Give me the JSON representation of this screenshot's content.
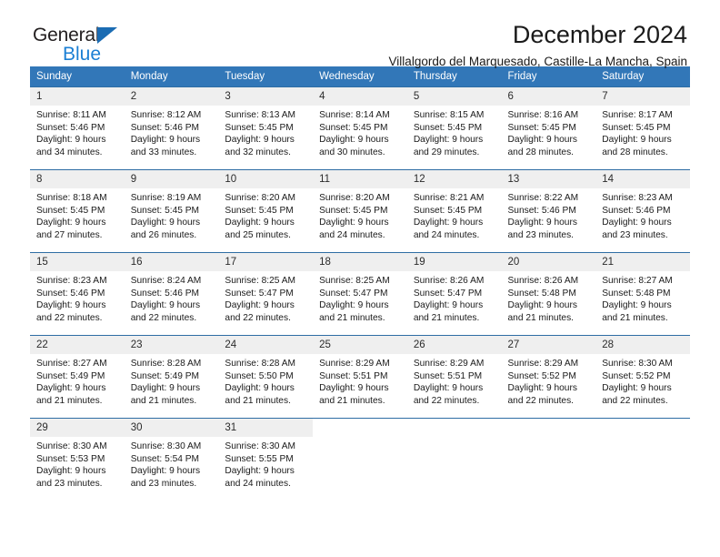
{
  "brand": {
    "line1": "General",
    "line2": "Blue",
    "color_dark": "#231f20",
    "color_blue": "#1b7fd4",
    "triangle_color": "#1b6cb3"
  },
  "header": {
    "title": "December 2024",
    "subtitle": "Villalgordo del Marquesado, Castille-La Mancha, Spain"
  },
  "theme": {
    "header_bg": "#3277b8",
    "rule_color": "#2e6da4",
    "daynum_bg": "#efefef"
  },
  "weekdays": [
    "Sunday",
    "Monday",
    "Tuesday",
    "Wednesday",
    "Thursday",
    "Friday",
    "Saturday"
  ],
  "weeks": [
    [
      {
        "day": "1",
        "sunrise": "Sunrise: 8:11 AM",
        "sunset": "Sunset: 5:46 PM",
        "daylight1": "Daylight: 9 hours",
        "daylight2": "and 34 minutes."
      },
      {
        "day": "2",
        "sunrise": "Sunrise: 8:12 AM",
        "sunset": "Sunset: 5:46 PM",
        "daylight1": "Daylight: 9 hours",
        "daylight2": "and 33 minutes."
      },
      {
        "day": "3",
        "sunrise": "Sunrise: 8:13 AM",
        "sunset": "Sunset: 5:45 PM",
        "daylight1": "Daylight: 9 hours",
        "daylight2": "and 32 minutes."
      },
      {
        "day": "4",
        "sunrise": "Sunrise: 8:14 AM",
        "sunset": "Sunset: 5:45 PM",
        "daylight1": "Daylight: 9 hours",
        "daylight2": "and 30 minutes."
      },
      {
        "day": "5",
        "sunrise": "Sunrise: 8:15 AM",
        "sunset": "Sunset: 5:45 PM",
        "daylight1": "Daylight: 9 hours",
        "daylight2": "and 29 minutes."
      },
      {
        "day": "6",
        "sunrise": "Sunrise: 8:16 AM",
        "sunset": "Sunset: 5:45 PM",
        "daylight1": "Daylight: 9 hours",
        "daylight2": "and 28 minutes."
      },
      {
        "day": "7",
        "sunrise": "Sunrise: 8:17 AM",
        "sunset": "Sunset: 5:45 PM",
        "daylight1": "Daylight: 9 hours",
        "daylight2": "and 28 minutes."
      }
    ],
    [
      {
        "day": "8",
        "sunrise": "Sunrise: 8:18 AM",
        "sunset": "Sunset: 5:45 PM",
        "daylight1": "Daylight: 9 hours",
        "daylight2": "and 27 minutes."
      },
      {
        "day": "9",
        "sunrise": "Sunrise: 8:19 AM",
        "sunset": "Sunset: 5:45 PM",
        "daylight1": "Daylight: 9 hours",
        "daylight2": "and 26 minutes."
      },
      {
        "day": "10",
        "sunrise": "Sunrise: 8:20 AM",
        "sunset": "Sunset: 5:45 PM",
        "daylight1": "Daylight: 9 hours",
        "daylight2": "and 25 minutes."
      },
      {
        "day": "11",
        "sunrise": "Sunrise: 8:20 AM",
        "sunset": "Sunset: 5:45 PM",
        "daylight1": "Daylight: 9 hours",
        "daylight2": "and 24 minutes."
      },
      {
        "day": "12",
        "sunrise": "Sunrise: 8:21 AM",
        "sunset": "Sunset: 5:45 PM",
        "daylight1": "Daylight: 9 hours",
        "daylight2": "and 24 minutes."
      },
      {
        "day": "13",
        "sunrise": "Sunrise: 8:22 AM",
        "sunset": "Sunset: 5:46 PM",
        "daylight1": "Daylight: 9 hours",
        "daylight2": "and 23 minutes."
      },
      {
        "day": "14",
        "sunrise": "Sunrise: 8:23 AM",
        "sunset": "Sunset: 5:46 PM",
        "daylight1": "Daylight: 9 hours",
        "daylight2": "and 23 minutes."
      }
    ],
    [
      {
        "day": "15",
        "sunrise": "Sunrise: 8:23 AM",
        "sunset": "Sunset: 5:46 PM",
        "daylight1": "Daylight: 9 hours",
        "daylight2": "and 22 minutes."
      },
      {
        "day": "16",
        "sunrise": "Sunrise: 8:24 AM",
        "sunset": "Sunset: 5:46 PM",
        "daylight1": "Daylight: 9 hours",
        "daylight2": "and 22 minutes."
      },
      {
        "day": "17",
        "sunrise": "Sunrise: 8:25 AM",
        "sunset": "Sunset: 5:47 PM",
        "daylight1": "Daylight: 9 hours",
        "daylight2": "and 22 minutes."
      },
      {
        "day": "18",
        "sunrise": "Sunrise: 8:25 AM",
        "sunset": "Sunset: 5:47 PM",
        "daylight1": "Daylight: 9 hours",
        "daylight2": "and 21 minutes."
      },
      {
        "day": "19",
        "sunrise": "Sunrise: 8:26 AM",
        "sunset": "Sunset: 5:47 PM",
        "daylight1": "Daylight: 9 hours",
        "daylight2": "and 21 minutes."
      },
      {
        "day": "20",
        "sunrise": "Sunrise: 8:26 AM",
        "sunset": "Sunset: 5:48 PM",
        "daylight1": "Daylight: 9 hours",
        "daylight2": "and 21 minutes."
      },
      {
        "day": "21",
        "sunrise": "Sunrise: 8:27 AM",
        "sunset": "Sunset: 5:48 PM",
        "daylight1": "Daylight: 9 hours",
        "daylight2": "and 21 minutes."
      }
    ],
    [
      {
        "day": "22",
        "sunrise": "Sunrise: 8:27 AM",
        "sunset": "Sunset: 5:49 PM",
        "daylight1": "Daylight: 9 hours",
        "daylight2": "and 21 minutes."
      },
      {
        "day": "23",
        "sunrise": "Sunrise: 8:28 AM",
        "sunset": "Sunset: 5:49 PM",
        "daylight1": "Daylight: 9 hours",
        "daylight2": "and 21 minutes."
      },
      {
        "day": "24",
        "sunrise": "Sunrise: 8:28 AM",
        "sunset": "Sunset: 5:50 PM",
        "daylight1": "Daylight: 9 hours",
        "daylight2": "and 21 minutes."
      },
      {
        "day": "25",
        "sunrise": "Sunrise: 8:29 AM",
        "sunset": "Sunset: 5:51 PM",
        "daylight1": "Daylight: 9 hours",
        "daylight2": "and 21 minutes."
      },
      {
        "day": "26",
        "sunrise": "Sunrise: 8:29 AM",
        "sunset": "Sunset: 5:51 PM",
        "daylight1": "Daylight: 9 hours",
        "daylight2": "and 22 minutes."
      },
      {
        "day": "27",
        "sunrise": "Sunrise: 8:29 AM",
        "sunset": "Sunset: 5:52 PM",
        "daylight1": "Daylight: 9 hours",
        "daylight2": "and 22 minutes."
      },
      {
        "day": "28",
        "sunrise": "Sunrise: 8:30 AM",
        "sunset": "Sunset: 5:52 PM",
        "daylight1": "Daylight: 9 hours",
        "daylight2": "and 22 minutes."
      }
    ],
    [
      {
        "day": "29",
        "sunrise": "Sunrise: 8:30 AM",
        "sunset": "Sunset: 5:53 PM",
        "daylight1": "Daylight: 9 hours",
        "daylight2": "and 23 minutes."
      },
      {
        "day": "30",
        "sunrise": "Sunrise: 8:30 AM",
        "sunset": "Sunset: 5:54 PM",
        "daylight1": "Daylight: 9 hours",
        "daylight2": "and 23 minutes."
      },
      {
        "day": "31",
        "sunrise": "Sunrise: 8:30 AM",
        "sunset": "Sunset: 5:55 PM",
        "daylight1": "Daylight: 9 hours",
        "daylight2": "and 24 minutes."
      },
      {
        "day": "",
        "sunrise": "",
        "sunset": "",
        "daylight1": "",
        "daylight2": ""
      },
      {
        "day": "",
        "sunrise": "",
        "sunset": "",
        "daylight1": "",
        "daylight2": ""
      },
      {
        "day": "",
        "sunrise": "",
        "sunset": "",
        "daylight1": "",
        "daylight2": ""
      },
      {
        "day": "",
        "sunrise": "",
        "sunset": "",
        "daylight1": "",
        "daylight2": ""
      }
    ]
  ]
}
